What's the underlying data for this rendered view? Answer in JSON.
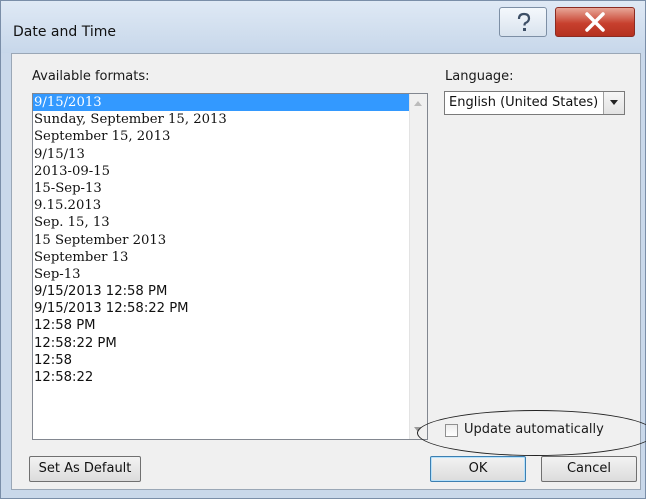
{
  "window": {
    "title": "Date and Time"
  },
  "formats": {
    "label": "Available formats:",
    "items": [
      "9/15/2013",
      "Sunday, September 15, 2013",
      "September 15, 2013",
      "9/15/13",
      "2013-09-15",
      "15-Sep-13",
      "9.15.2013",
      "Sep. 15, 13",
      "15 September 2013",
      "September 13",
      "Sep-13",
      "9/15/2013 12:58 PM",
      "9/15/2013 12:58:22 PM",
      "12:58 PM",
      "12:58:22 PM",
      "12:58",
      "12:58:22"
    ],
    "selected": "9/15/2013"
  },
  "language": {
    "label": "Language:",
    "value": "English (United States)"
  },
  "update": {
    "label": "Update automatically",
    "checked": false
  },
  "buttons": {
    "set_default": "Set As Default",
    "ok": "OK",
    "cancel": "Cancel"
  },
  "icons": {
    "help": "help-icon",
    "close": "close-icon",
    "dropdown": "chevron-down-icon",
    "scroll_up": "scroll-up-icon",
    "scroll_down": "scroll-down-icon"
  },
  "colors": {
    "selection": "#3399ff",
    "close_button": "#c7402e",
    "annotation_ellipse": "#222222"
  }
}
